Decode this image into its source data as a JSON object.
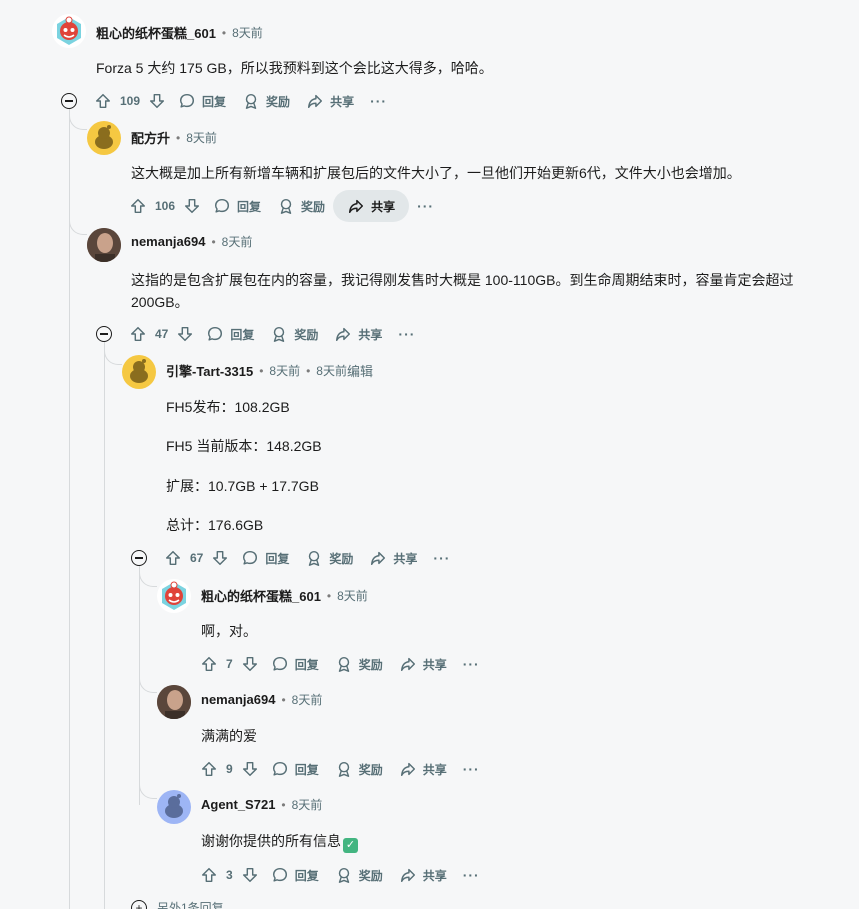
{
  "labels": {
    "dot": "•",
    "reply": "回复",
    "award": "奖励",
    "share": "共享",
    "more": "···"
  },
  "comments": {
    "c1": {
      "user": "粗心的纸杯蛋糕_601",
      "time": "8天前",
      "text": "Forza 5 大约 175 GB，所以我预料到这个会比这大得多，哈哈。",
      "votes": "109"
    },
    "c2": {
      "user": "配方升",
      "time": "8天前",
      "text": "这大概是加上所有新增车辆和扩展包后的文件大小了，一旦他们开始更新6代，文件大小也会增加。",
      "votes": "106"
    },
    "c3": {
      "user": "nemanja694",
      "time": "8天前",
      "text": "这指的是包含扩展包在内的容量，我记得刚发售时大概是 100-110GB。到生命周期结束时，容量肯定会超过 200GB。",
      "votes": "47"
    },
    "c4": {
      "user": "引擎-Tart-3315",
      "time": "8天前",
      "time2": "8天前",
      "edited": "编辑",
      "lines": [
        "FH5发布：108.2GB",
        "FH5 当前版本：148.2GB",
        "扩展：10.7GB + 17.7GB",
        "总计：176.6GB"
      ],
      "votes": "67"
    },
    "c5": {
      "user": "粗心的纸杯蛋糕_601",
      "time": "8天前",
      "text": "啊，对。",
      "votes": "7"
    },
    "c6": {
      "user": "nemanja694",
      "time": "8天前",
      "text": "满满的爱",
      "votes": "9"
    },
    "c7": {
      "user": "Agent_S721",
      "time": "8天前",
      "text": "谢谢你提供的所有信息",
      "emoji": "✓",
      "votes": "3"
    }
  },
  "more_replies": "另外1条回复",
  "colors": {
    "background": "#f6f7f8",
    "thread_line": "#d7dadc",
    "action_text": "#576f76",
    "share_active_bg": "#e2e7e9"
  }
}
